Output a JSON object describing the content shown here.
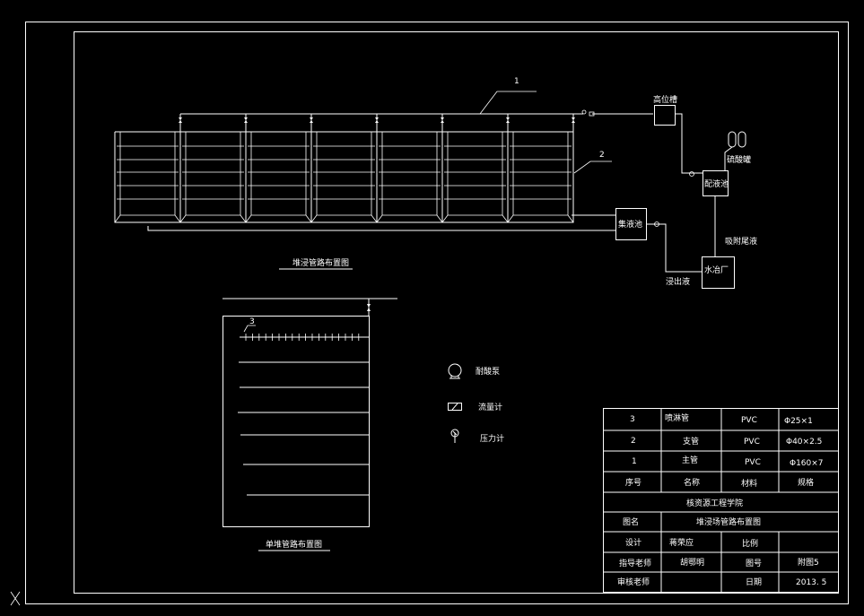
{
  "main_plan": {
    "title": "堆浸管路布置图",
    "label_1": "1",
    "label_2": "2",
    "high_tank": "高位槽",
    "sulfuric_tank": "硫酸罐",
    "mixing_pool": "配液池",
    "collection_pool": "集液池",
    "adsorption_tail": "吸附尾液",
    "water_plant": "水冶厂",
    "leachate": "浸出液"
  },
  "single_heap": {
    "title": "单堆管路布置图",
    "label_3": "3"
  },
  "legend": [
    {
      "icon": "acid-pump-icon",
      "label": "耐酸泵"
    },
    {
      "icon": "flowmeter-icon",
      "label": "流量计"
    },
    {
      "icon": "pressure-gauge-icon",
      "label": "压力计"
    }
  ],
  "title_block": {
    "rows": [
      {
        "no": "3",
        "name": "喷淋管",
        "material": "PVC",
        "spec": "Φ25×1"
      },
      {
        "no": "2",
        "name": "支管",
        "material": "PVC",
        "spec": "Φ40×2.5"
      },
      {
        "no": "1",
        "name": "主管",
        "material": "PVC",
        "spec": "Φ160×7"
      }
    ],
    "header": {
      "no": "序号",
      "name": "名称",
      "material": "材料",
      "spec": "规格"
    },
    "institution": "核资源工程学院",
    "figure_label": "图名",
    "figure_name": "堆浸场管路布置图",
    "design_label": "设计",
    "designer": "蒋荣应",
    "scale_label": "比例",
    "scale_value": "",
    "advisor_label": "指导老师",
    "advisor": "胡鄂明",
    "drawing_no_label": "图号",
    "drawing_no": "附图5",
    "reviewer_label": "审核老师",
    "reviewer": "",
    "date_label": "日期",
    "date": "2013. 5"
  },
  "colors": {
    "background": "#000000",
    "line": "#ffffff"
  }
}
